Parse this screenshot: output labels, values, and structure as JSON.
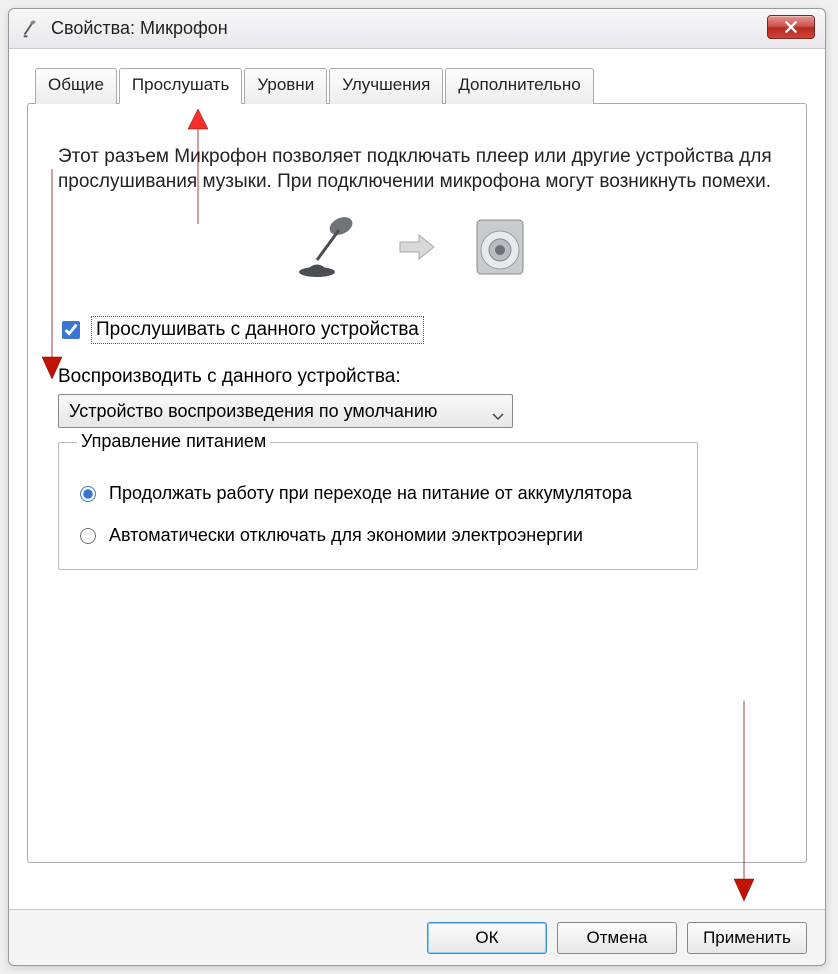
{
  "window": {
    "title": "Свойства: Микрофон"
  },
  "tabs": {
    "general": "Общие",
    "listen": "Прослушать",
    "levels": "Уровни",
    "enhancements": "Улучшения",
    "advanced": "Дополнительно",
    "active": "listen"
  },
  "listenTab": {
    "description": "Этот разъем Микрофон позволяет подключать плеер или другие устройства для прослушивания музыки. При подключении микрофона могут возникнуть помехи.",
    "checkbox_label": "Прослушивать с данного устройства",
    "checkbox_checked": true,
    "playback_label": "Воспроизводить с данного устройства:",
    "playback_selected": "Устройство воспроизведения по умолчанию",
    "power_group": "Управление питанием",
    "radio_continue": "Продолжать работу при переходе на питание от аккумулятора",
    "radio_auto_off": "Автоматически отключать для экономии электроэнергии",
    "radio_selected": "continue"
  },
  "buttons": {
    "ok": "ОК",
    "cancel": "Отмена",
    "apply": "Применить"
  }
}
